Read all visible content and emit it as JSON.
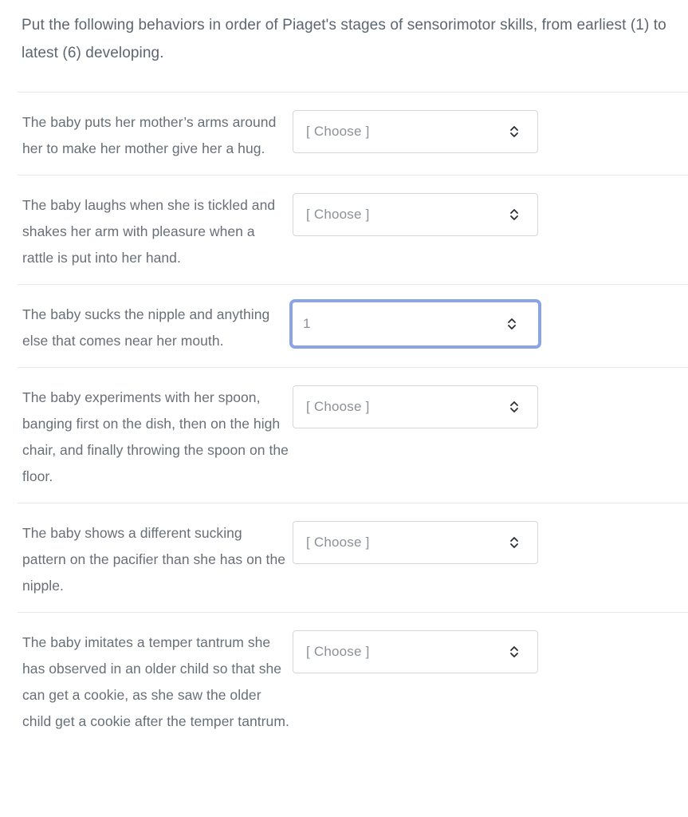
{
  "question": {
    "prompt": "Put the following behaviors in order of Piaget's stages of sensorimotor skills, from earliest (1) to latest (6) developing.",
    "placeholder_label": "[ Choose ]",
    "dropdown_icon": "chevron-up-down-icon",
    "focus_color": "#8ba4e8",
    "text_color": "#686f77",
    "border_color": "#d4d7da",
    "divider_color": "#e6e7e8",
    "items": [
      {
        "text": "The baby puts her mother’s arms around her to make her mother give her a hug.",
        "selected": "[ Choose ]",
        "focused": false
      },
      {
        "text": "The baby laughs when she is tickled and shakes her arm with pleasure when a rattle is put into her hand.",
        "selected": "[ Choose ]",
        "focused": false
      },
      {
        "text": "The baby sucks the nipple and anything else that comes near her mouth.",
        "selected": "1",
        "focused": true
      },
      {
        "text": "The baby experiments with her spoon, banging first on the dish, then on the high chair, and finally throwing the spoon on the floor.",
        "selected": "[ Choose ]",
        "focused": false
      },
      {
        "text": "The baby shows a different sucking pattern on the pacifier than she has on the nipple.",
        "selected": "[ Choose ]",
        "focused": false
      },
      {
        "text": "The baby imitates a temper tantrum she has observed in an older child so that she can get a cookie, as she saw the older child get a cookie after the temper tantrum.",
        "selected": "[ Choose ]",
        "focused": false
      }
    ]
  }
}
